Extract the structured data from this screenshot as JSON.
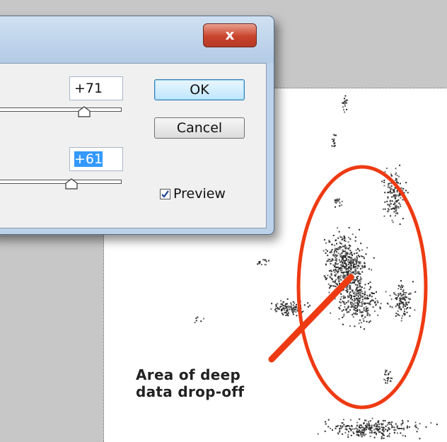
{
  "dialog": {
    "close_label": "x",
    "field1_value": "+71",
    "field2_value": "+61",
    "ok_label": "OK",
    "cancel_label": "Cancel",
    "preview_label": "Preview",
    "preview_checked": true,
    "slider1_position": 0.71,
    "slider2_position": 0.61
  },
  "annotation": {
    "line1": "Area of deep",
    "line2": "data drop-off",
    "color": "#ee3a12"
  }
}
